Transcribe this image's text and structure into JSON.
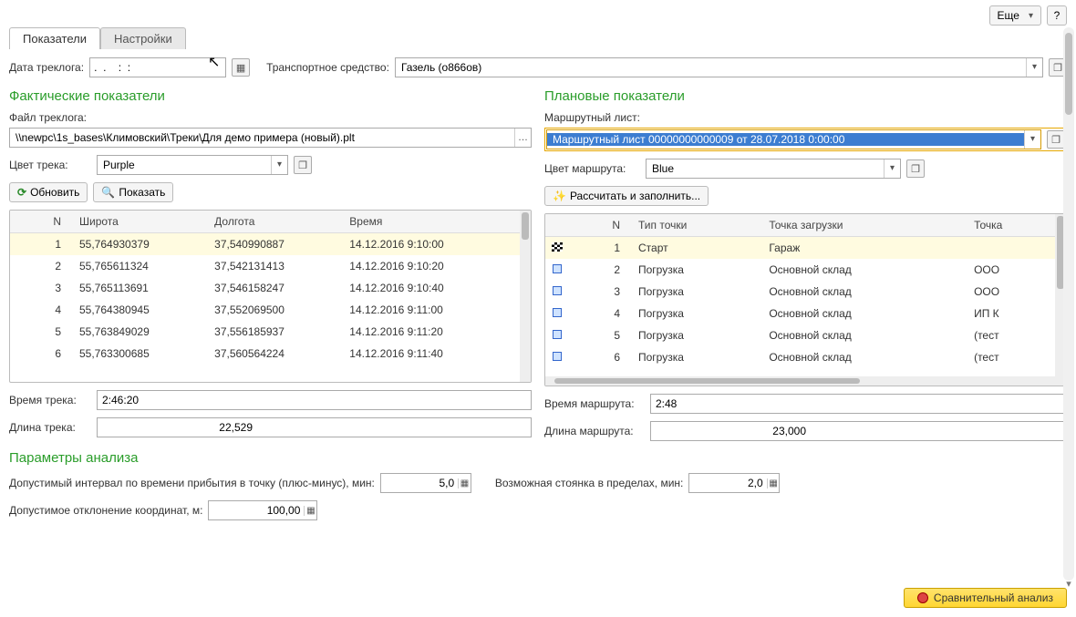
{
  "top": {
    "more": "Еще",
    "help": "?"
  },
  "tabs": {
    "indicators": "Показатели",
    "settings": "Настройки"
  },
  "header": {
    "tracklog_date_label": "Дата треклога:",
    "tracklog_date_value": ".  .    :  :",
    "vehicle_label": "Транспортное средство:",
    "vehicle_value": "Газель (о866ов)"
  },
  "facts": {
    "title": "Фактические показатели",
    "file_label": "Файл треклога:",
    "file_value": "\\\\newpc\\1s_bases\\Климовский\\Треки\\Для демо примера (новый).plt",
    "track_color_label": "Цвет трека:",
    "track_color_value": "Purple",
    "refresh_btn": "Обновить",
    "show_btn": "Показать",
    "track_time_label": "Время трека:",
    "track_time_value": "2:46:20",
    "track_len_label": "Длина трека:",
    "track_len_value": "22,529",
    "table": {
      "headers": {
        "n": "N",
        "lat": "Широта",
        "lon": "Долгота",
        "time": "Время"
      },
      "rows": [
        {
          "n": "1",
          "lat": "55,764930379",
          "lon": "37,540990887",
          "time": "14.12.2016 9:10:00"
        },
        {
          "n": "2",
          "lat": "55,765611324",
          "lon": "37,542131413",
          "time": "14.12.2016 9:10:20"
        },
        {
          "n": "3",
          "lat": "55,765113691",
          "lon": "37,546158247",
          "time": "14.12.2016 9:10:40"
        },
        {
          "n": "4",
          "lat": "55,764380945",
          "lon": "37,552069500",
          "time": "14.12.2016 9:11:00"
        },
        {
          "n": "5",
          "lat": "55,763849029",
          "lon": "37,556185937",
          "time": "14.12.2016 9:11:20"
        },
        {
          "n": "6",
          "lat": "55,763300685",
          "lon": "37,560564224",
          "time": "14.12.2016 9:11:40"
        }
      ]
    }
  },
  "plan": {
    "title": "Плановые показатели",
    "route_list_label": "Маршрутный лист:",
    "route_list_value": "Маршрутный лист 00000000000009 от 28.07.2018 0:00:00",
    "route_color_label": "Цвет маршрута:",
    "route_color_value": "Blue",
    "calc_btn": "Рассчитать и заполнить...",
    "route_time_label": "Время маршрута:",
    "route_time_value": "2:48",
    "route_len_label": "Длина маршрута:",
    "route_len_value": "23,000",
    "table": {
      "headers": {
        "n": "N",
        "ptype": "Тип точки",
        "load": "Точка загрузки",
        "point": "Точка"
      },
      "rows": [
        {
          "icon": "finish",
          "n": "1",
          "ptype": "Старт",
          "load": "Гараж",
          "point": ""
        },
        {
          "icon": "stage",
          "n": "2",
          "ptype": "Погрузка",
          "load": "Основной склад",
          "point": "ООО"
        },
        {
          "icon": "stage",
          "n": "3",
          "ptype": "Погрузка",
          "load": "Основной склад",
          "point": "ООО"
        },
        {
          "icon": "stage",
          "n": "4",
          "ptype": "Погрузка",
          "load": "Основной склад",
          "point": "ИП К"
        },
        {
          "icon": "stage",
          "n": "5",
          "ptype": "Погрузка",
          "load": "Основной склад",
          "point": "(тест"
        },
        {
          "icon": "stage",
          "n": "6",
          "ptype": "Погрузка",
          "load": "Основной склад",
          "point": "(тест"
        }
      ]
    }
  },
  "params": {
    "title": "Параметры анализа",
    "interval_label": "Допустимый интервал по времени прибытия в точку (плюс-минус), мин:",
    "interval_value": "5,0",
    "parking_label": "Возможная стоянка в пределах, мин:",
    "parking_value": "2,0",
    "coord_dev_label": "Допустимое отклонение координат, м:",
    "coord_dev_value": "100,00"
  },
  "footer": {
    "compare_btn": "Сравнительный анализ"
  }
}
